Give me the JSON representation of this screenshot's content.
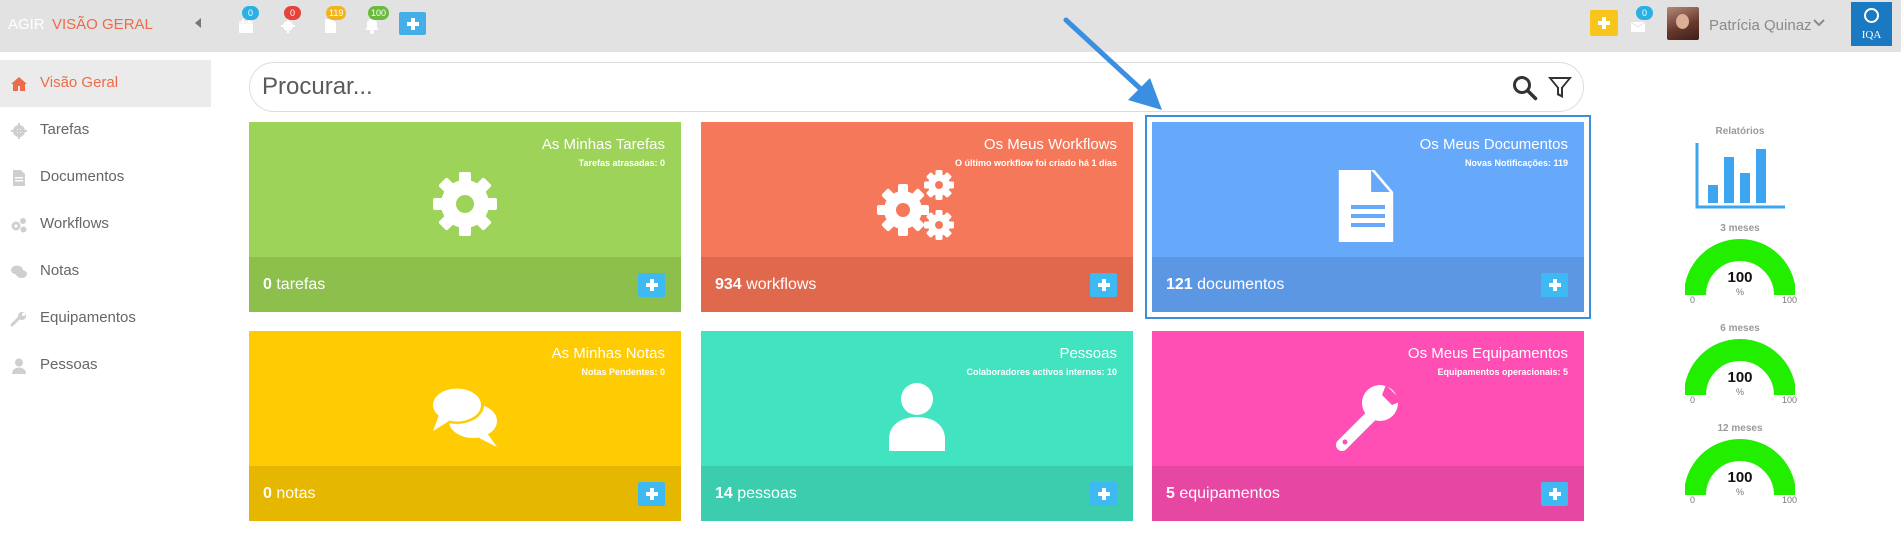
{
  "header": {
    "brand": "AGIR",
    "section": "VISÃO GERAL",
    "badges": {
      "calendar": "0",
      "tasks": "0",
      "documents": "119",
      "notifications": "100",
      "messages": "0"
    },
    "user_name": "Patrícia Quinaz",
    "logo_text": "IQA"
  },
  "sidebar": {
    "items": [
      {
        "label": "Visão Geral",
        "icon": "home-icon",
        "active": true
      },
      {
        "label": "Tarefas",
        "icon": "gear-icon"
      },
      {
        "label": "Documentos",
        "icon": "document-icon"
      },
      {
        "label": "Workflows",
        "icon": "gears-icon"
      },
      {
        "label": "Notas",
        "icon": "comments-icon"
      },
      {
        "label": "Equipamentos",
        "icon": "wrench-icon"
      },
      {
        "label": "Pessoas",
        "icon": "user-icon"
      }
    ]
  },
  "search": {
    "placeholder": "Procurar..."
  },
  "tiles": [
    {
      "title": "As Minhas Tarefas",
      "subtitle": "Tarefas atrasadas: 0",
      "count": "0",
      "unit": "tarefas",
      "color": "#9ed35a",
      "footer_color": "#8cbf4c",
      "icon": "gear-icon"
    },
    {
      "title": "Os Meus Workflows",
      "subtitle": "O último workflow foi criado há 1 dias",
      "count": "934",
      "unit": "workflows",
      "color": "#f6785a",
      "footer_color": "#e0694d",
      "icon": "gears-icon"
    },
    {
      "title": "Os Meus Documentos",
      "subtitle": "Novas Notificações: 119",
      "count": "121",
      "unit": "documentos",
      "color": "#66a9fb",
      "footer_color": "#5c97e3",
      "icon": "document-icon"
    },
    {
      "title": "As Minhas Notas",
      "subtitle": "Notas Pendentes: 0",
      "count": "0",
      "unit": "notas",
      "color": "#ffcb02",
      "footer_color": "#e6b700",
      "icon": "comments-icon"
    },
    {
      "title": "Pessoas",
      "subtitle": "Colaboradores activos internos: 10",
      "count": "14",
      "unit": "pessoas",
      "color": "#42e3c1",
      "footer_color": "#3bcdae",
      "icon": "user-icon"
    },
    {
      "title": "Os Meus Equipamentos",
      "subtitle": "Equipamentos operacionais: 5",
      "count": "5",
      "unit": "equipamentos",
      "color": "#ff4eb4",
      "footer_color": "#e647a3",
      "icon": "wrench-icon"
    }
  ],
  "right_panel": {
    "reports_label": "Relatórios",
    "gauges": [
      {
        "label": "3 meses",
        "value": "100",
        "unit": "%",
        "min": "0",
        "max": "100",
        "level": 1.0,
        "color": "#22ee00"
      },
      {
        "label": "6 meses",
        "value": "100",
        "unit": "%",
        "min": "0",
        "max": "100",
        "level": 1.0,
        "color": "#22ee00"
      },
      {
        "label": "12 meses",
        "value": "100",
        "unit": "%",
        "min": "0",
        "max": "100",
        "level": 1.0,
        "color": "#22ee00"
      }
    ]
  }
}
